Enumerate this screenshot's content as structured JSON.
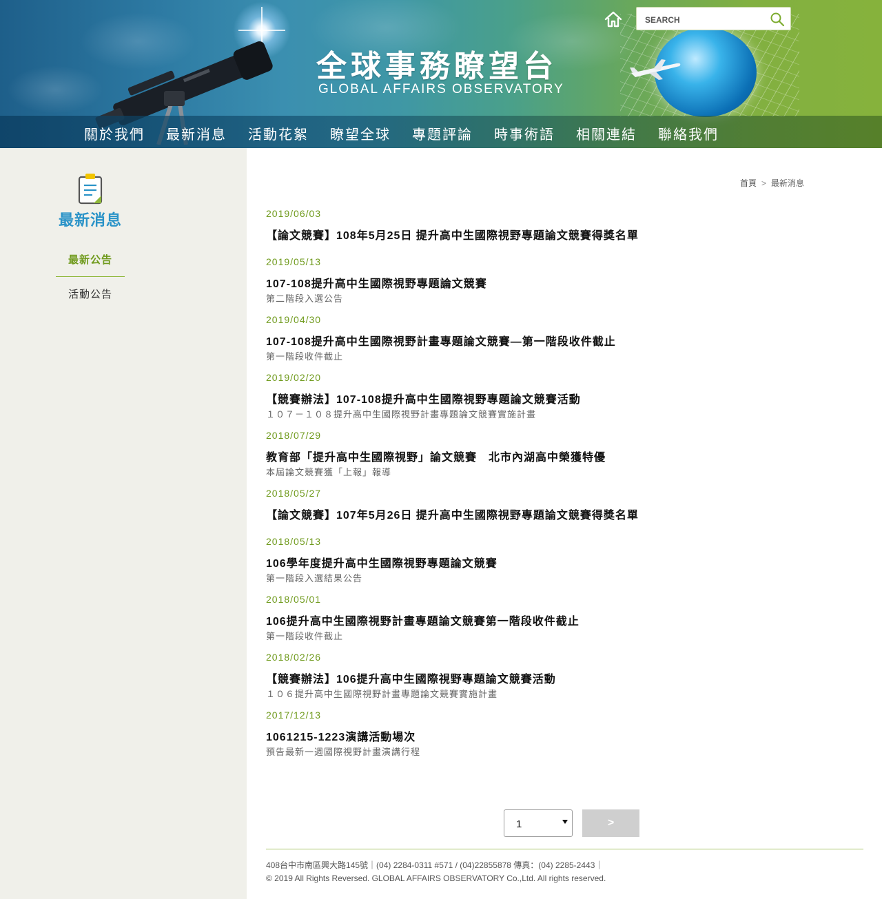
{
  "header": {
    "title_zh": "全球事務瞭望台",
    "title_en": "GLOBAL AFFAIRS OBSERVATORY",
    "search_placeholder": "SEARCH"
  },
  "nav": {
    "items": [
      "關於我們",
      "最新消息",
      "活動花絮",
      "瞭望全球",
      "專題評論",
      "時事術語",
      "相關連結",
      "聯絡我們"
    ]
  },
  "sidebar": {
    "title": "最新消息",
    "items": [
      {
        "label": "最新公告",
        "active": true
      },
      {
        "label": "活動公告",
        "active": false
      }
    ]
  },
  "breadcrumb": {
    "home": "首頁",
    "separator": ">",
    "current": "最新消息"
  },
  "news": [
    {
      "date": "2019/06/03",
      "title": "【論文競賽】108年5月25日 提升高中生國際視野專題論文競賽得獎名單",
      "subtitle": ""
    },
    {
      "date": "2019/05/13",
      "title": "107-108提升高中生國際視野專題論文競賽",
      "subtitle": "第二階段入選公告"
    },
    {
      "date": "2019/04/30",
      "title": "107-108提升高中生國際視野計畫專題論文競賽—第一階段收件截止",
      "subtitle": "第一階段收件截止"
    },
    {
      "date": "2019/02/20",
      "title": "【競賽辦法】107-108提升高中生國際視野專題論文競賽活動",
      "subtitle": "１０７－１０８提升高中生國際視野計畫專題論文競賽實施計畫"
    },
    {
      "date": "2018/07/29",
      "title": "教育部「提升高中生國際視野」論文競賽　北市內湖高中榮獲特優",
      "subtitle": "本屆論文競賽獲「上報」報導"
    },
    {
      "date": "2018/05/27",
      "title": "【論文競賽】107年5月26日 提升高中生國際視野專題論文競賽得獎名單",
      "subtitle": ""
    },
    {
      "date": "2018/05/13",
      "title": "106學年度提升高中生國際視野專題論文競賽",
      "subtitle": "第一階段入選結果公告"
    },
    {
      "date": "2018/05/01",
      "title": "106提升高中生國際視野計畫專題論文競賽第一階段收件截止",
      "subtitle": "第一階段收件截止"
    },
    {
      "date": "2018/02/26",
      "title": "【競賽辦法】106提升高中生國際視野專題論文競賽活動",
      "subtitle": "１０６提升高中生國際視野計畫專題論文競賽實施計畫"
    },
    {
      "date": "2017/12/13",
      "title": "1061215-1223演講活動場次",
      "subtitle": "預告最新一週國際視野計畫演講行程"
    }
  ],
  "pager": {
    "page_value": "1",
    "next_label": ">"
  },
  "footer": {
    "address": "408台中市南區興大路145號｜(04) 2284-0311 #571 / (04)22855878 傳真：(04) 2285-2443｜",
    "copyright": "© 2019 All Rights Reversed. GLOBAL AFFAIRS OBSERVATORY Co.,Ltd. All rights reserved."
  },
  "colors": {
    "accent_green": "#6f9a1c",
    "sidebar_title_blue": "#2a93c8",
    "sidebar_bg": "#f0f0ea"
  },
  "icons": [
    "home-icon",
    "search-icon",
    "clipboard-icon",
    "dropdown-arrow-icon"
  ]
}
